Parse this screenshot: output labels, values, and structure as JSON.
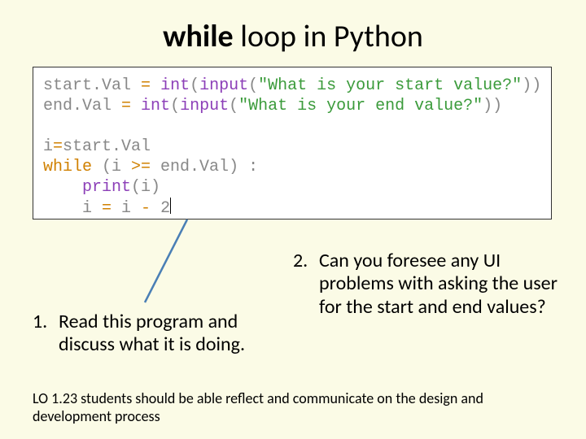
{
  "title": {
    "bold": "while",
    "rest": " loop in Python"
  },
  "code": {
    "l1a": "start.Val ",
    "l1_eq": "=",
    "l1b": " ",
    "l1_int": "int",
    "l1c": "(",
    "l1_input": "input",
    "l1d": "(",
    "l1_str": "\"What is your start value?\"",
    "l1e": "))",
    "l2a": "end.Val ",
    "l2_eq": "=",
    "l2b": " ",
    "l2_int": "int",
    "l2c": "(",
    "l2_input": "input",
    "l2d": "(",
    "l2_str": "\"What is your end value?\"",
    "l2e": "))",
    "l4a": "i",
    "l4_eq": "=",
    "l4b": "start.Val",
    "l5_while": "while",
    "l5a": " (i ",
    "l5_ge": ">=",
    "l5b": " end.Val) :",
    "l6a": "    ",
    "l6_print": "print",
    "l6b": "(i)",
    "l7a": "    i ",
    "l7_eq": "=",
    "l7b": " i ",
    "l7_minus": "-",
    "l7c": " 2"
  },
  "q1": {
    "num": "1.",
    "text": "Read this program and discuss what it is doing."
  },
  "q2": {
    "num": "2.",
    "text": "Can you foresee any UI problems with asking the user for the start and end values?"
  },
  "lo": "LO 1.23 students should be able reflect and communicate on the design and development process"
}
